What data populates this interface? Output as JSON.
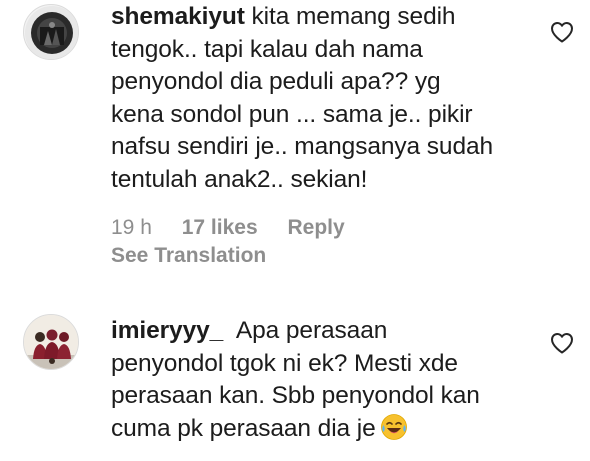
{
  "comments": [
    {
      "username": "shemakiyut",
      "lines": [
        "kita memang sedih",
        "tengok.. tapi kalau dah nama",
        "penyondol dia peduli apa?? yg",
        "kena sondol pun ... sama je.. pikir",
        "nafsu sendiri je.. mangsanya sudah",
        "tentulah anak2.. sekian!"
      ],
      "time": "19 h",
      "likes": "17 likes",
      "reply": "Reply",
      "see_translation": "See Translation"
    },
    {
      "username": "imieryyy_",
      "lines": [
        "Apa perasaan",
        "penyondol tgok ni ek? Mesti xde",
        "perasaan kan. Sbb penyondol kan",
        "cuma pk perasaan dia je"
      ],
      "emoji": "face-with-tears-of-joy"
    }
  ],
  "icons": {
    "like": "heart-outline-icon"
  },
  "colors": {
    "text": "#1c1c1c",
    "secondary": "#8e8e8e",
    "avatar_border": "#dbdbdb"
  }
}
